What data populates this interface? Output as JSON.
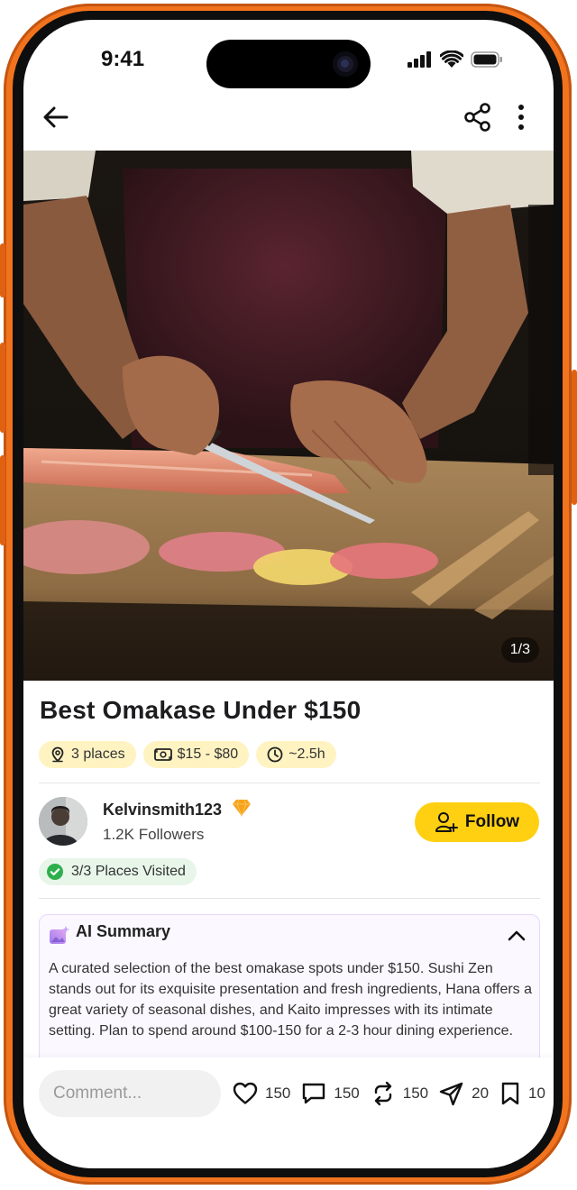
{
  "status_bar": {
    "time": "9:41"
  },
  "header": {
    "back_icon": "arrow-left-icon",
    "share_icon": "share-icon",
    "more_icon": "more-vertical-icon"
  },
  "hero": {
    "image_desc": "chef-slicing-fish-photo",
    "counter": "1/3"
  },
  "post": {
    "title": "Best Omakase Under $150",
    "chips": [
      {
        "icon": "location-pin-icon",
        "label": "3 places"
      },
      {
        "icon": "money-icon",
        "label": "$15 - $80"
      },
      {
        "icon": "clock-icon",
        "label": "~2.5h"
      }
    ]
  },
  "author": {
    "username": "Kelvinsmith123",
    "badge_icon": "diamond-icon",
    "followers": "1.2K Followers",
    "follow_label": "Follow",
    "visited": "3/3 Places Visited"
  },
  "ai_summary": {
    "title": "AI Summary",
    "text": "A curated selection of the best omakase spots under $150. Sushi Zen stands out for its exquisite presentation and fresh ingredients, Hana offers a great variety of seasonal dishes, and Kaito impresses with its intimate setting. Plan to spend around $100-150 for a 2-3 hour dining experience."
  },
  "bottom_bar": {
    "comment_placeholder": "Comment...",
    "likes": "150",
    "comments": "150",
    "reposts": "150",
    "shares": "20",
    "saves": "10"
  },
  "colors": {
    "accent": "#FFD012",
    "frame": "#F2731D",
    "chip_bg": "#FFF3C2",
    "visited_bg": "#E8F6EA",
    "check_green": "#2EAF4D",
    "ai_border": "#E6D9FB"
  }
}
